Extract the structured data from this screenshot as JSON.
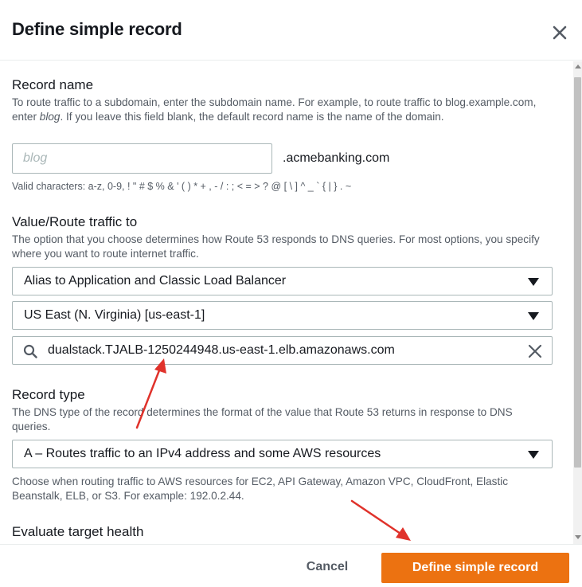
{
  "dialog": {
    "title": "Define simple record"
  },
  "record_name": {
    "label": "Record name",
    "desc_pre": "To route traffic to a subdomain, enter the subdomain name. For example, to route traffic to blog.example.com, enter ",
    "desc_em": "blog",
    "desc_post": ". If you leave this field blank, the default record name is the name of the domain.",
    "placeholder": "blog",
    "value": "",
    "domain_suffix": ".acmebanking.com",
    "valid_chars": "Valid characters: a-z, 0-9, ! \" # $ % & ' ( ) * + , - / : ; < = > ? @ [ \\ ] ^ _ ` { | } . ~"
  },
  "route_traffic": {
    "label": "Value/Route traffic to",
    "desc": "The option that you choose determines how Route 53 responds to DNS queries. For most options, you specify where you want to route internet traffic.",
    "endpoint_select": "Alias to Application and Classic Load Balancer",
    "region_select": "US East (N. Virginia) [us-east-1]",
    "load_balancer_value": "dualstack.TJALB-1250244948.us-east-1.elb.amazonaws.com"
  },
  "record_type": {
    "label": "Record type",
    "desc": "The DNS type of the record determines the format of the value that Route 53 returns in response to DNS queries.",
    "selected": "A – Routes traffic to an IPv4 address and some AWS resources",
    "help": "Choose when routing traffic to AWS resources for EC2, API Gateway, Amazon VPC, CloudFront, Elastic Beanstalk, ELB, or S3. For example: 192.0.2.44."
  },
  "evaluate_health": {
    "label": "Evaluate target health"
  },
  "footer": {
    "cancel_label": "Cancel",
    "submit_label": "Define simple record"
  },
  "colors": {
    "primary": "#ec7211",
    "annotation_arrow": "#e0322b",
    "text": "#16191f",
    "secondary_text": "#545b64",
    "border": "#aab7b8"
  },
  "icons": {
    "close": "close-icon",
    "search": "search-icon",
    "clear": "clear-icon",
    "caret": "caret-down-icon"
  }
}
